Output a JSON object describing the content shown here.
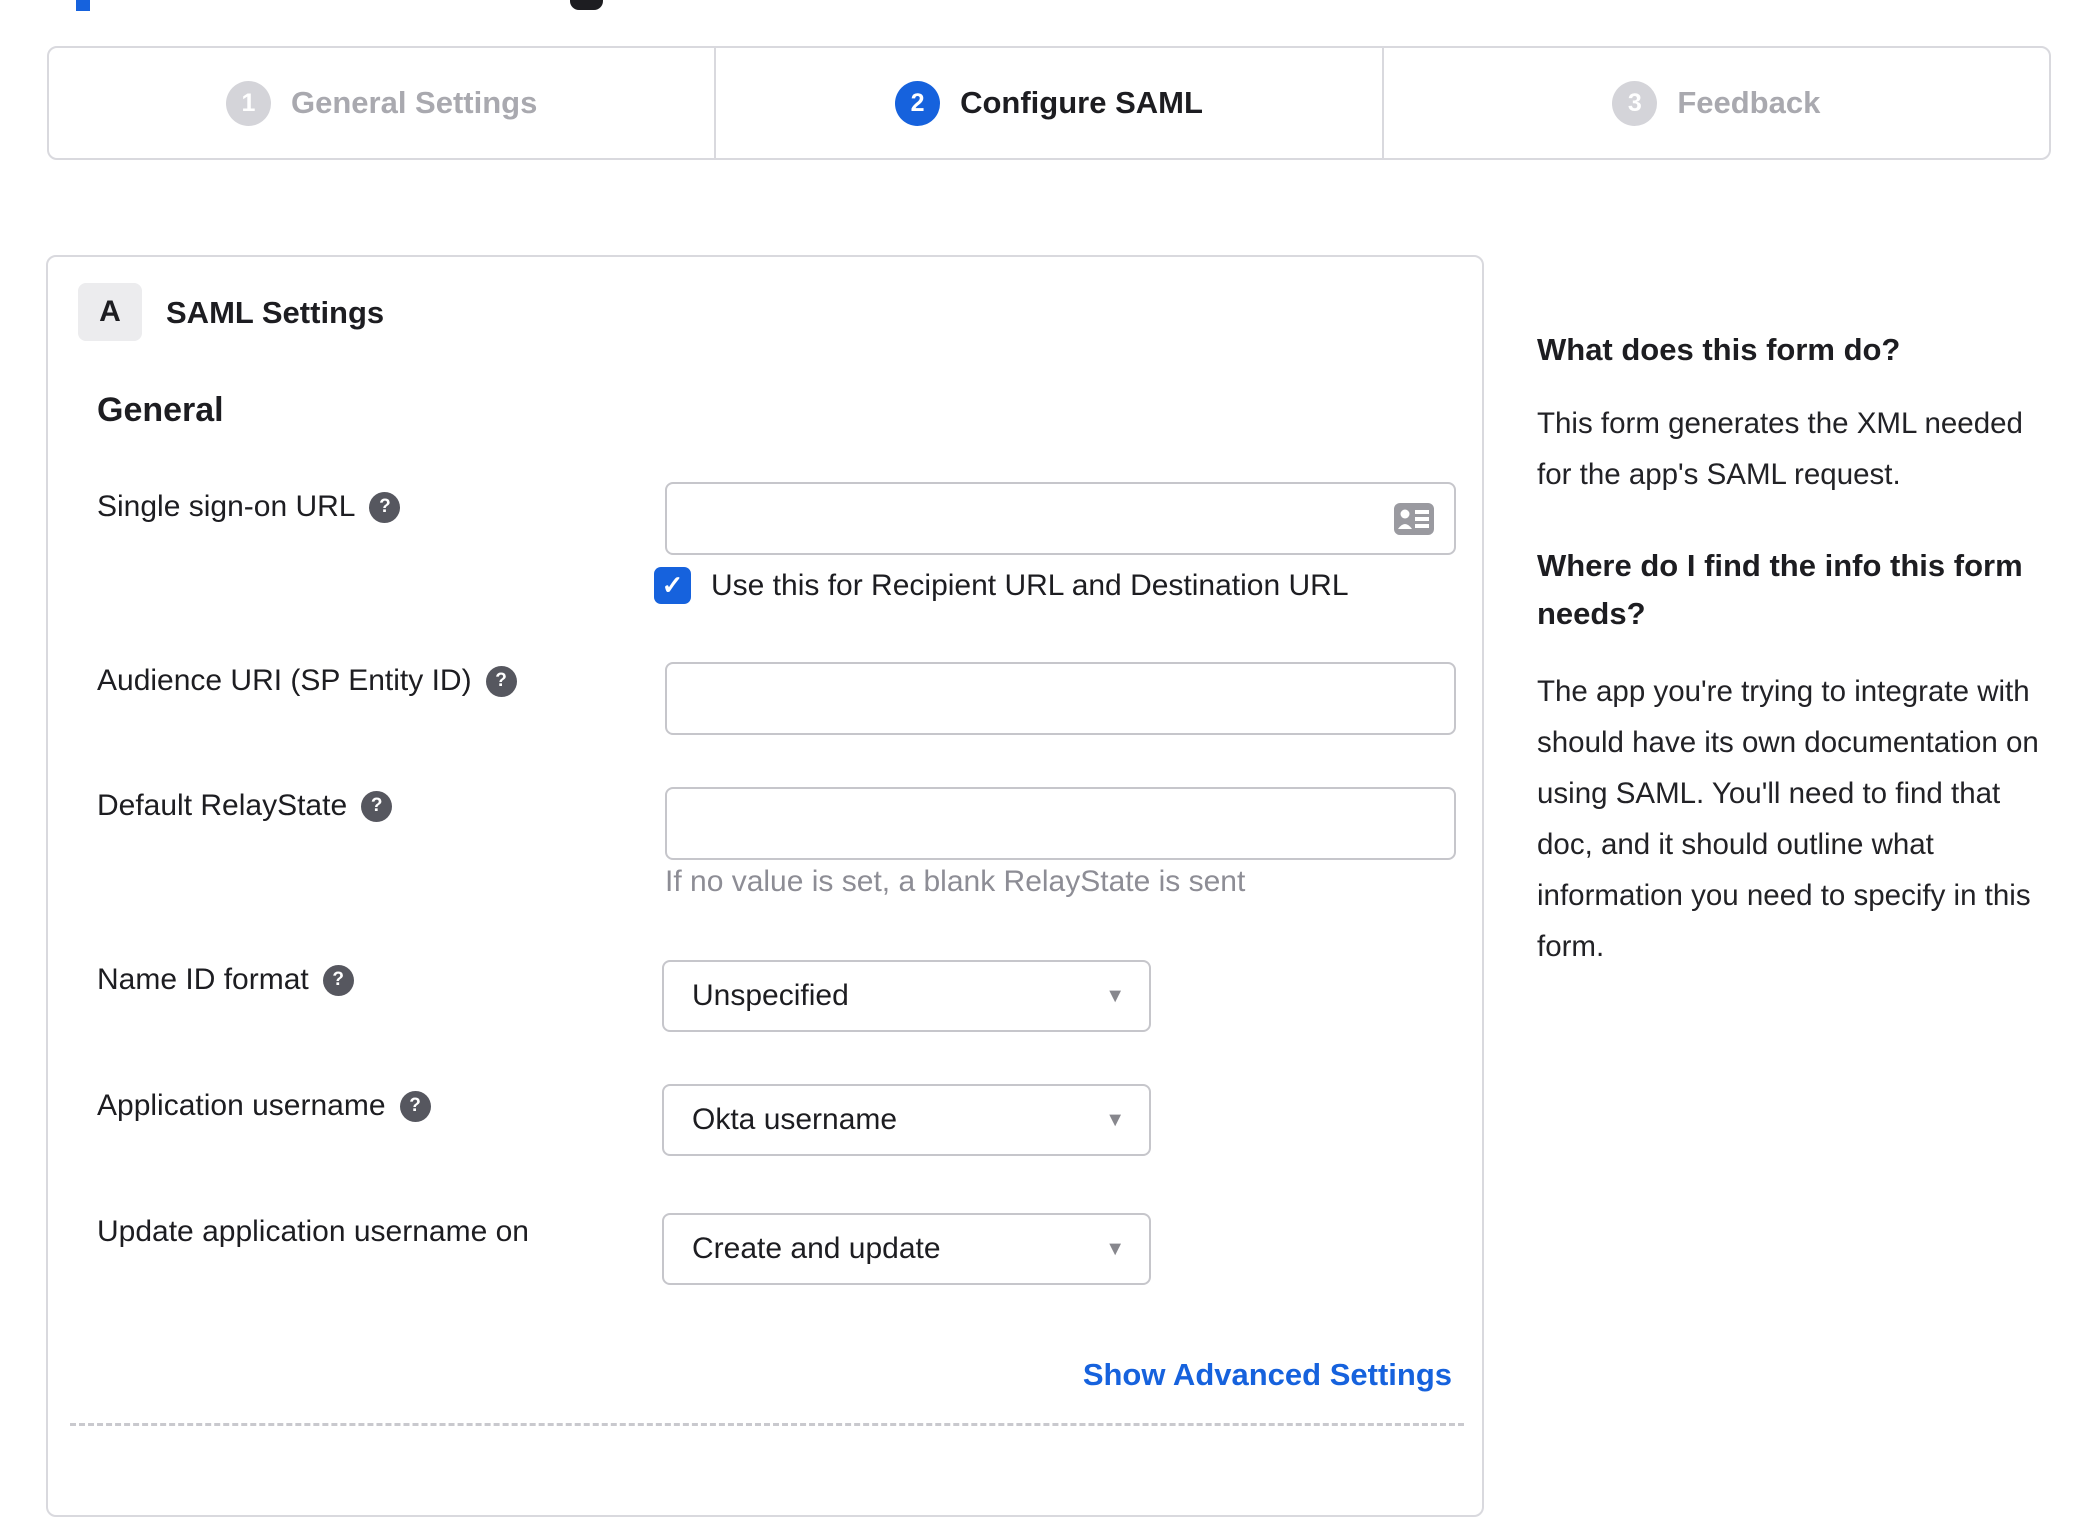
{
  "colors": {
    "accent_blue": "#1662dd",
    "border_gray": "#d9d9de",
    "input_border": "#c6c6cb",
    "text_dark": "#1d1d21",
    "inactive_gray": "#a9a9af",
    "hint_gray": "#8d8d95"
  },
  "icons": {
    "help": "?",
    "checkmark": "✓",
    "dropdown_arrow": "▼"
  },
  "stepper": {
    "steps": [
      {
        "number": "1",
        "label": "General Settings",
        "state": "inactive"
      },
      {
        "number": "2",
        "label": "Configure SAML",
        "state": "active"
      },
      {
        "number": "3",
        "label": "Feedback",
        "state": "inactive"
      }
    ]
  },
  "panel": {
    "badge": "A",
    "title": "SAML Settings",
    "section_heading": "General",
    "fields": {
      "sso": {
        "label": "Single sign-on URL",
        "value": "",
        "checkbox_label": "Use this for Recipient URL and Destination URL",
        "checkbox_checked": true
      },
      "audience": {
        "label": "Audience URI (SP Entity ID)",
        "value": ""
      },
      "relay": {
        "label": "Default RelayState",
        "value": "",
        "hint": "If no value is set, a blank RelayState is sent"
      },
      "name_id": {
        "label": "Name ID format",
        "value": "Unspecified"
      },
      "app_username": {
        "label": "Application username",
        "value": "Okta username"
      },
      "update_username": {
        "label": "Update application username on",
        "value": "Create and update"
      }
    },
    "advanced_link": "Show Advanced Settings"
  },
  "sidebar": {
    "heading_1": "What does this form do?",
    "para_1": "This form generates the XML needed\nfor the app's SAML request.",
    "heading_2": "Where do I find the info this form\nneeds?",
    "para_2": "The app you're trying to integrate with\nshould have its own documentation on\nusing SAML. You'll need to find that\ndoc, and it should outline what\ninformation you need to specify in this\nform."
  }
}
